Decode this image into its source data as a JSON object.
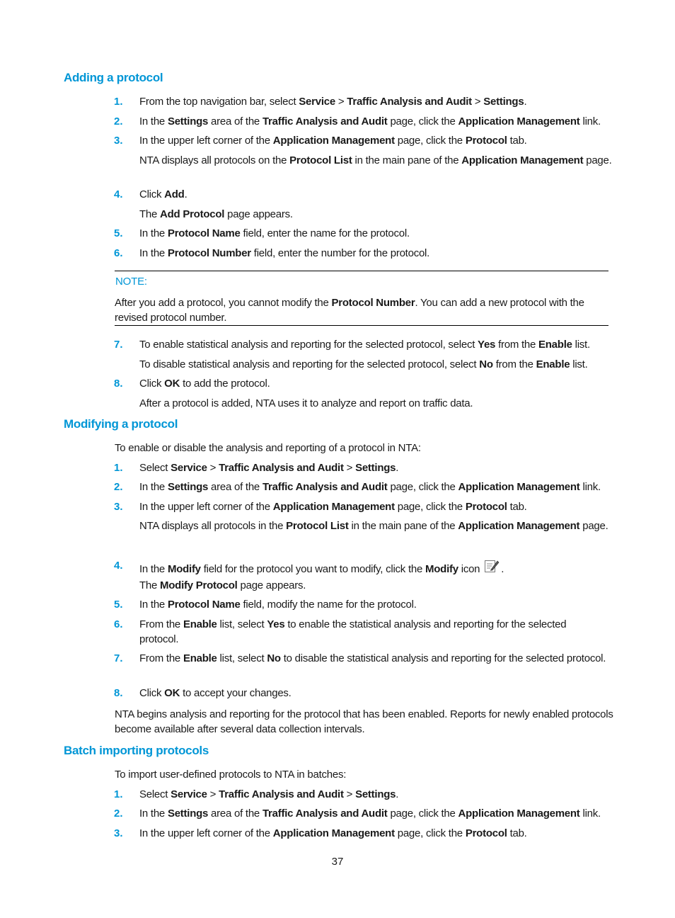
{
  "sections": {
    "adding": {
      "heading": "Adding a protocol",
      "steps": [
        {
          "num": "1.",
          "parts": [
            "From the top navigation bar, select ",
            "Service",
            " > ",
            "Traffic Analysis and Audit",
            " > ",
            "Settings",
            "."
          ]
        },
        {
          "num": "2.",
          "parts": [
            "In the ",
            "Settings",
            " area of the ",
            "Traffic Analysis and Audit",
            " page, click the ",
            "Application Management",
            " link."
          ]
        },
        {
          "num": "3.",
          "parts": [
            "In the upper left corner of the ",
            "Application Management",
            " page, click the ",
            "Protocol",
            " tab."
          ]
        },
        {
          "num": "4.",
          "parts": [
            "Click ",
            "Add",
            "."
          ]
        },
        {
          "num": "5.",
          "parts": [
            "In the ",
            "Protocol Name",
            " field, enter the name for the protocol."
          ]
        },
        {
          "num": "6.",
          "parts": [
            "In the ",
            "Protocol Number",
            " field, enter the number for the protocol."
          ]
        },
        {
          "num": "7.",
          "parts": [
            "To enable statistical analysis and reporting for the selected protocol, select ",
            "Yes",
            " from the ",
            "Enable",
            " list."
          ]
        },
        {
          "num": "8.",
          "parts": [
            "Click ",
            "OK",
            " to add the protocol."
          ]
        }
      ],
      "step3_sub": [
        "NTA displays all protocols on the ",
        "Protocol List",
        " in the main pane of the ",
        "Application Management",
        " page."
      ],
      "step4_sub": [
        "The ",
        "Add Protocol",
        " page appears."
      ],
      "step7_sub": [
        "To disable statistical analysis and reporting for the selected protocol, select ",
        "No",
        " from the ",
        "Enable",
        " list."
      ],
      "step8_sub": "After a protocol is added, NTA uses it to analyze and report on traffic data.",
      "note": {
        "label": "NOTE:",
        "parts": [
          "After you add a protocol, you cannot modify the ",
          "Protocol Number",
          ". You can add a new protocol with the revised protocol number."
        ]
      }
    },
    "modifying": {
      "heading": "Modifying a protocol",
      "intro": "To enable or disable the analysis and reporting of a protocol in NTA:",
      "steps": [
        {
          "num": "1.",
          "parts": [
            "Select ",
            "Service",
            " > ",
            "Traffic Analysis and Audit",
            " > ",
            "Settings",
            "."
          ]
        },
        {
          "num": "2.",
          "parts": [
            "In the ",
            "Settings",
            " area of the ",
            "Traffic Analysis and Audit",
            " page, click the ",
            "Application Management",
            " link."
          ]
        },
        {
          "num": "3.",
          "parts": [
            "In the upper left corner of the ",
            "Application Management",
            " page, click the ",
            "Protocol",
            " tab."
          ]
        },
        {
          "num": "4.",
          "parts": [
            "In the ",
            "Modify",
            " field for the protocol you want to modify, click the ",
            "Modify",
            " icon "
          ],
          "trail": "."
        },
        {
          "num": "5.",
          "parts": [
            "In the ",
            "Protocol Name",
            " field, modify the name for the protocol."
          ]
        },
        {
          "num": "6.",
          "parts": [
            "From the ",
            "Enable",
            " list, select ",
            "Yes",
            " to enable the statistical analysis and reporting for the selected protocol."
          ]
        },
        {
          "num": "7.",
          "parts": [
            "From the ",
            "Enable",
            " list, select ",
            "No",
            " to disable the statistical analysis and reporting for the selected protocol."
          ]
        },
        {
          "num": "8.",
          "parts": [
            "Click ",
            "OK",
            " to accept your changes."
          ]
        }
      ],
      "step3_sub": [
        "NTA displays all protocols in the ",
        "Protocol List",
        " in the main pane of the ",
        "Application Management",
        " page."
      ],
      "step4_sub": [
        "The ",
        "Modify Protocol",
        " page appears."
      ],
      "outro": "NTA begins analysis and reporting for the protocol that has been enabled. Reports for newly enabled protocols become available after several data collection intervals.",
      "icon": "edit-icon"
    },
    "batch": {
      "heading": "Batch importing protocols",
      "intro": "To import user-defined protocols to NTA in batches:",
      "steps": [
        {
          "num": "1.",
          "parts": [
            "Select ",
            "Service",
            " > ",
            "Traffic Analysis and Audit",
            " > ",
            "Settings",
            "."
          ]
        },
        {
          "num": "2.",
          "parts": [
            "In the ",
            "Settings",
            " area of the ",
            "Traffic Analysis and Audit",
            " page, click the ",
            "Application Management",
            " link."
          ]
        },
        {
          "num": "3.",
          "parts": [
            "In the upper left corner of the ",
            "Application Management",
            " page, click the ",
            "Protocol",
            " tab."
          ]
        }
      ]
    }
  },
  "page_number": "37",
  "colors": {
    "accent": "#0096d6",
    "text": "#1a1a1a"
  }
}
